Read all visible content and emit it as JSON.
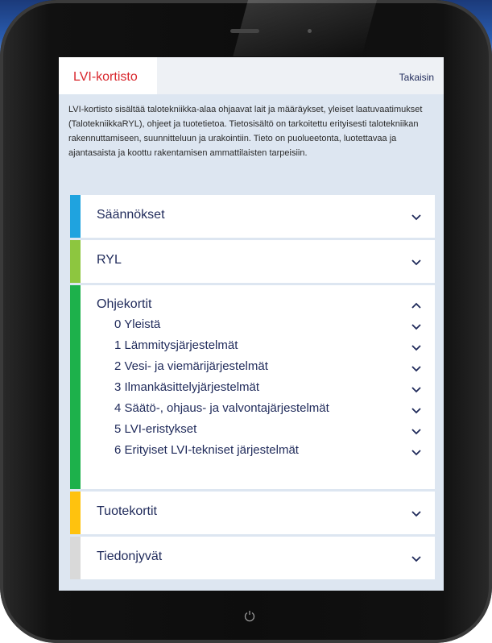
{
  "app": {
    "title": "LVI-kortisto",
    "back_label": "Takaisin",
    "intro": "LVI-kortisto sisältää talotekniikka-alaa ohjaavat lait ja määräykset, yleiset laatuvaatimukset (TalotekniikkaRYL), ohjeet ja tuotetietoa. Tietosisältö on tarkoitettu erityisesti talotekniikan rakennuttamiseen, suunnitteluun ja urakointiin. Tieto on puolueetonta, luotettavaa ja ajantasaista ja koottu rakentamisen ammattilaisten tarpeisiin."
  },
  "sections": [
    {
      "label": "Säännökset",
      "color": "#1fa3df",
      "expanded": false
    },
    {
      "label": "RYL",
      "color": "#8dc63f",
      "expanded": false
    },
    {
      "label": "Ohjekortit",
      "color": "#1db14b",
      "expanded": true,
      "items": [
        "0 Yleistä",
        "1 Lämmitysjärjestelmät",
        "2 Vesi- ja viemärijärjestelmät",
        "3 Ilmankäsittelyjärjestelmät",
        "4 Säätö-, ohjaus- ja valvontajärjestelmät",
        "5 LVI-eristykset",
        "6 Erityiset LVI-tekniset järjestelmät"
      ]
    },
    {
      "label": "Tuotekortit",
      "color": "#ffc20e",
      "expanded": false
    },
    {
      "label": "Tiedonjyvät",
      "color": "#d9d9d9",
      "expanded": false
    }
  ],
  "colors": {
    "accent_red": "#d8262c",
    "text_navy": "#1f2a5a"
  },
  "icons": {
    "chevron_down": "chevron-down-icon",
    "chevron_up": "chevron-up-icon",
    "home": "power-icon"
  }
}
